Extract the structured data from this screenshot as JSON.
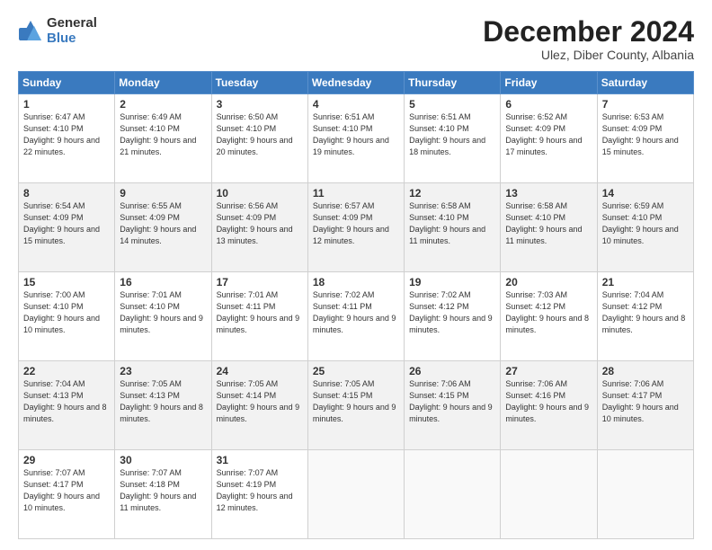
{
  "logo": {
    "general": "General",
    "blue": "Blue"
  },
  "title": "December 2024",
  "subtitle": "Ulez, Diber County, Albania",
  "headers": [
    "Sunday",
    "Monday",
    "Tuesday",
    "Wednesday",
    "Thursday",
    "Friday",
    "Saturday"
  ],
  "weeks": [
    [
      {
        "day": "1",
        "sunrise": "6:47 AM",
        "sunset": "4:10 PM",
        "daylight": "9 hours and 22 minutes."
      },
      {
        "day": "2",
        "sunrise": "6:49 AM",
        "sunset": "4:10 PM",
        "daylight": "9 hours and 21 minutes."
      },
      {
        "day": "3",
        "sunrise": "6:50 AM",
        "sunset": "4:10 PM",
        "daylight": "9 hours and 20 minutes."
      },
      {
        "day": "4",
        "sunrise": "6:51 AM",
        "sunset": "4:10 PM",
        "daylight": "9 hours and 19 minutes."
      },
      {
        "day": "5",
        "sunrise": "6:51 AM",
        "sunset": "4:10 PM",
        "daylight": "9 hours and 18 minutes."
      },
      {
        "day": "6",
        "sunrise": "6:52 AM",
        "sunset": "4:09 PM",
        "daylight": "9 hours and 17 minutes."
      },
      {
        "day": "7",
        "sunrise": "6:53 AM",
        "sunset": "4:09 PM",
        "daylight": "9 hours and 15 minutes."
      }
    ],
    [
      {
        "day": "8",
        "sunrise": "6:54 AM",
        "sunset": "4:09 PM",
        "daylight": "9 hours and 15 minutes."
      },
      {
        "day": "9",
        "sunrise": "6:55 AM",
        "sunset": "4:09 PM",
        "daylight": "9 hours and 14 minutes."
      },
      {
        "day": "10",
        "sunrise": "6:56 AM",
        "sunset": "4:09 PM",
        "daylight": "9 hours and 13 minutes."
      },
      {
        "day": "11",
        "sunrise": "6:57 AM",
        "sunset": "4:09 PM",
        "daylight": "9 hours and 12 minutes."
      },
      {
        "day": "12",
        "sunrise": "6:58 AM",
        "sunset": "4:10 PM",
        "daylight": "9 hours and 11 minutes."
      },
      {
        "day": "13",
        "sunrise": "6:58 AM",
        "sunset": "4:10 PM",
        "daylight": "9 hours and 11 minutes."
      },
      {
        "day": "14",
        "sunrise": "6:59 AM",
        "sunset": "4:10 PM",
        "daylight": "9 hours and 10 minutes."
      }
    ],
    [
      {
        "day": "15",
        "sunrise": "7:00 AM",
        "sunset": "4:10 PM",
        "daylight": "9 hours and 10 minutes."
      },
      {
        "day": "16",
        "sunrise": "7:01 AM",
        "sunset": "4:10 PM",
        "daylight": "9 hours and 9 minutes."
      },
      {
        "day": "17",
        "sunrise": "7:01 AM",
        "sunset": "4:11 PM",
        "daylight": "9 hours and 9 minutes."
      },
      {
        "day": "18",
        "sunrise": "7:02 AM",
        "sunset": "4:11 PM",
        "daylight": "9 hours and 9 minutes."
      },
      {
        "day": "19",
        "sunrise": "7:02 AM",
        "sunset": "4:12 PM",
        "daylight": "9 hours and 9 minutes."
      },
      {
        "day": "20",
        "sunrise": "7:03 AM",
        "sunset": "4:12 PM",
        "daylight": "9 hours and 8 minutes."
      },
      {
        "day": "21",
        "sunrise": "7:04 AM",
        "sunset": "4:12 PM",
        "daylight": "9 hours and 8 minutes."
      }
    ],
    [
      {
        "day": "22",
        "sunrise": "7:04 AM",
        "sunset": "4:13 PM",
        "daylight": "9 hours and 8 minutes."
      },
      {
        "day": "23",
        "sunrise": "7:05 AM",
        "sunset": "4:13 PM",
        "daylight": "9 hours and 8 minutes."
      },
      {
        "day": "24",
        "sunrise": "7:05 AM",
        "sunset": "4:14 PM",
        "daylight": "9 hours and 9 minutes."
      },
      {
        "day": "25",
        "sunrise": "7:05 AM",
        "sunset": "4:15 PM",
        "daylight": "9 hours and 9 minutes."
      },
      {
        "day": "26",
        "sunrise": "7:06 AM",
        "sunset": "4:15 PM",
        "daylight": "9 hours and 9 minutes."
      },
      {
        "day": "27",
        "sunrise": "7:06 AM",
        "sunset": "4:16 PM",
        "daylight": "9 hours and 9 minutes."
      },
      {
        "day": "28",
        "sunrise": "7:06 AM",
        "sunset": "4:17 PM",
        "daylight": "9 hours and 10 minutes."
      }
    ],
    [
      {
        "day": "29",
        "sunrise": "7:07 AM",
        "sunset": "4:17 PM",
        "daylight": "9 hours and 10 minutes."
      },
      {
        "day": "30",
        "sunrise": "7:07 AM",
        "sunset": "4:18 PM",
        "daylight": "9 hours and 11 minutes."
      },
      {
        "day": "31",
        "sunrise": "7:07 AM",
        "sunset": "4:19 PM",
        "daylight": "9 hours and 12 minutes."
      },
      null,
      null,
      null,
      null
    ]
  ]
}
